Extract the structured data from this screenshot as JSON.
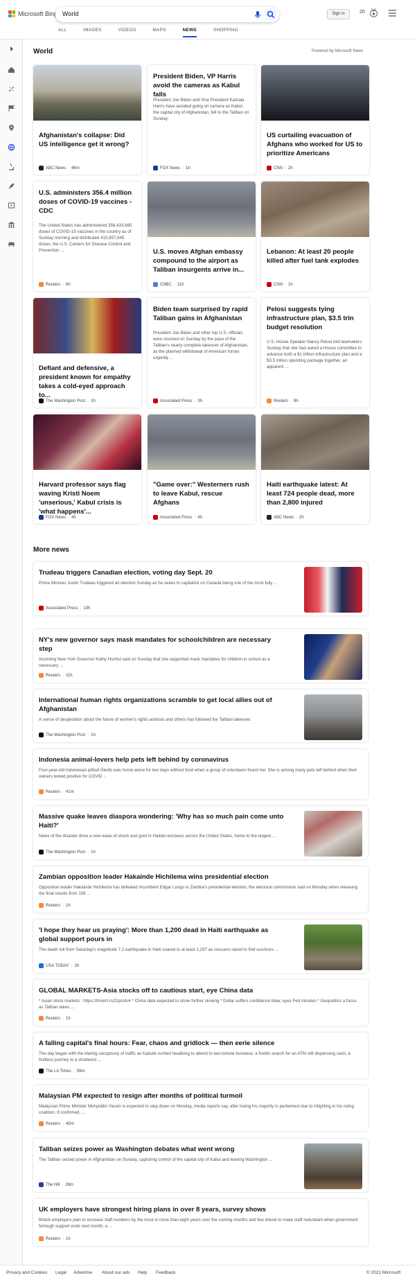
{
  "header": {
    "logo": "Microsoft Bing",
    "query": "World",
    "signin": "Sign in",
    "points": "20",
    "tabs": [
      "ALL",
      "IMAGES",
      "VIDEOS",
      "MAPS",
      "NEWS",
      "SHOPPING"
    ]
  },
  "section": {
    "title": "World",
    "powered": "Powered by Microsoft News"
  },
  "cards": [
    {
      "title": "Afghanistan's collapse: Did US intelligence get it wrong?",
      "snippet": "",
      "source": "ABC News",
      "time": "46m",
      "color": "#222"
    },
    {
      "title": "President Biden, VP Harris avoid the cameras as Kabul falls",
      "snippet": "President Joe Biden and Vice President Kamala Harris have avoided going on camera as Kabul, the capital city of Afghanistan, fell to the Taliban on Sunday.",
      "source": "FOX News",
      "time": "1h",
      "color": "#1a3a8a"
    },
    {
      "title": "US curtailing evacuation of Afghans who worked for US to prioritize Americans",
      "snippet": "",
      "source": "CNN",
      "time": "2h",
      "color": "#cc0000"
    },
    {
      "title": "U.S. administers 356.4 million doses of COVID-19 vaccines - CDC",
      "snippet": "The United States has administered 356,433,665 doses of COVID-19 vaccines in the country as of Sunday morning and distributed 415,957,645 doses, the U.S. Centers for Disease Control and Prevention ...",
      "source": "Reuters",
      "time": "6h",
      "color": "#f08a3c"
    },
    {
      "title": "U.S. moves Afghan embassy compound to the airport as Taliban insurgents arrive in...",
      "snippet": "",
      "source": "CNBC",
      "time": "11h",
      "color": "#4a7fd4"
    },
    {
      "title": "Lebanon: At least 20 people killed after fuel tank explodes",
      "snippet": "",
      "source": "CNN",
      "time": "1h",
      "color": "#cc0000"
    },
    {
      "title": "Defiant and defensive, a president known for empathy takes a cold-eyed approach to...",
      "snippet": "",
      "source": "The Washington Post",
      "time": "1h",
      "color": "#111"
    },
    {
      "title": "Biden team surprised by rapid Taliban gains in Afghanistan",
      "snippet": "President Joe Biden and other top U.S. officials were stunned on Sunday by the pace of the Taliban's nearly complete takeover of Afghanistan, as the planned withdrawal of American forces urgently ...",
      "source": "Associated Press",
      "time": "3h",
      "color": "#c00"
    },
    {
      "title": "Pelosi suggests tying infrastructure plan, $3.5 trln budget resolution",
      "snippet": "U.S. House Speaker Nancy Pelosi told lawmakers Sunday that she had asked a House committee to advance both a $1 trillion infrastructure plan and a $3.5 trillion spending package together, an apparent ...",
      "source": "Reuters",
      "time": "8h",
      "color": "#f08a3c"
    },
    {
      "title": "Harvard professor says flag waving Kristi Noem 'unserious,' Kabul crisis is 'what happens'...",
      "snippet": "",
      "source": "FOX News",
      "time": "4h",
      "color": "#1a3a8a"
    },
    {
      "title": "\"Game over:\" Westerners rush to leave Kabul, rescue Afghans",
      "snippet": "",
      "source": "Associated Press",
      "time": "4h",
      "color": "#c00"
    },
    {
      "title": "Haiti earthquake latest: At least 724 people dead, more than 2,800 injured",
      "snippet": "",
      "source": "ABC News",
      "time": "2h",
      "color": "#222"
    }
  ],
  "more": {
    "title": "More news",
    "items": [
      {
        "title": "Trudeau triggers Canadian election, voting day Sept. 20",
        "snippet": "Prime Minister Justin Trudeau triggered an election Sunday as he seeks to capitalize on Canada being one of the most fully ...",
        "source": "Associated Press",
        "time": "10h",
        "color": "#c00"
      },
      {
        "title": "NY's new governor says mask mandates for schoolchildren are necessary step",
        "snippet": "Incoming New York Governor Kathy Hochul said on Sunday that she supported mask mandates for children in school as a necessary ...",
        "source": "Reuters",
        "time": "11h",
        "color": "#f08a3c"
      },
      {
        "title": "International human rights organizations scramble to get local allies out of Afghanistan",
        "snippet": "A sense of desperation about the future of women's rights activists and others has followed the Taliban takeover.",
        "source": "The Washington Post",
        "time": "1h",
        "color": "#111"
      },
      {
        "title": "Indonesia animal-lovers help pets left behind by coronavirus",
        "snippet": "Four-year-old Indonesian pitbull Gledis was home alone for two days without food when a group of volunteers found her. She is among many pets left behind when their owners tested positive for COVID ...",
        "source": "Reuters",
        "time": "41m",
        "color": "#f08a3c"
      },
      {
        "title": "Massive quake leaves diaspora wondering: 'Why has so much pain come unto Haiti?'",
        "snippet": "News of the disaster drew a new wave of shock and grief in Haitian enclaves across the United States, home to the largest ...",
        "source": "The Washington Post",
        "time": "1h",
        "color": "#111"
      },
      {
        "title": "Zambian opposition leader Hakainde Hichilema wins presidential election",
        "snippet": "Opposition leader Hakainde Hichilema has defeated incumbent Edgar Lungu in Zambia's presidential election, the electoral commission said on Monday when releasing the final results from 156 ...",
        "source": "Reuters",
        "time": "1h",
        "color": "#f08a3c"
      },
      {
        "title": "'I hope they hear us praying': More than 1,200 dead in Haiti earthquake as global support pours in",
        "snippet": "The death toll from Saturday's magnitude 7.2 earthquake in Haiti soared to at least 1,297 as rescuers raced to find survivors ...",
        "source": "USA TODAY",
        "time": "2h",
        "color": "#1a6fd4"
      },
      {
        "title": "GLOBAL MARKETS-Asia stocks off to cautious start, eye China data",
        "snippet": "* Asian stock markets : https://tmsnrt.rs/2zpUAr4 * China data expected to show further slowing * Dollar suffers confidence blow, eyes Fed minutes * Geopolitics a focus as Taliban takes ...",
        "source": "Reuters",
        "time": "1h",
        "color": "#f08a3c"
      },
      {
        "title": "A falling capital's final hours: Fear, chaos and gridlock — then eerie silence",
        "snippet": "The day began with the blaring cacophony of traffic as Kabulis rushed headlong to attend to last-minute business: a frantic search for an ATM still dispensing cash, a fruitless journey to a shuttered ...",
        "source": "The LA Times",
        "time": "59m",
        "color": "#111"
      },
      {
        "title": "Malaysian PM expected to resign after months of political turmoil",
        "snippet": "Malaysian Prime Minister Muhyiddin Yassin is expected to step down on Monday, media reports say, after losing his majority in parliament due to infighting in his ruling coalition. If confirmed, ...",
        "source": "Reuters",
        "time": "45m",
        "color": "#f08a3c"
      },
      {
        "title": "Taliban seizes power as Washington debates what went wrong",
        "snippet": "The Taliban seized power in Afghanistan on Sunday, capturing control of the capital city of Kabul and leaving Washington ...",
        "source": "The Hill",
        "time": "26m",
        "color": "#2a3aa0"
      },
      {
        "title": "UK employers have strongest hiring plans in over 8 years, survey shows",
        "snippet": "British employers plan to increase staff numbers by the most in more than eight years over the coming months and few intend to make staff redundant when government furlough support ends next month, a ...",
        "source": "Reuters",
        "time": "1h",
        "color": "#f08a3c"
      }
    ]
  },
  "footer": {
    "links": [
      "Privacy and Cookies",
      "Legal",
      "Advertise",
      "About our ads",
      "Help",
      "Feedback"
    ],
    "copyright": "© 2021 Microsoft"
  }
}
